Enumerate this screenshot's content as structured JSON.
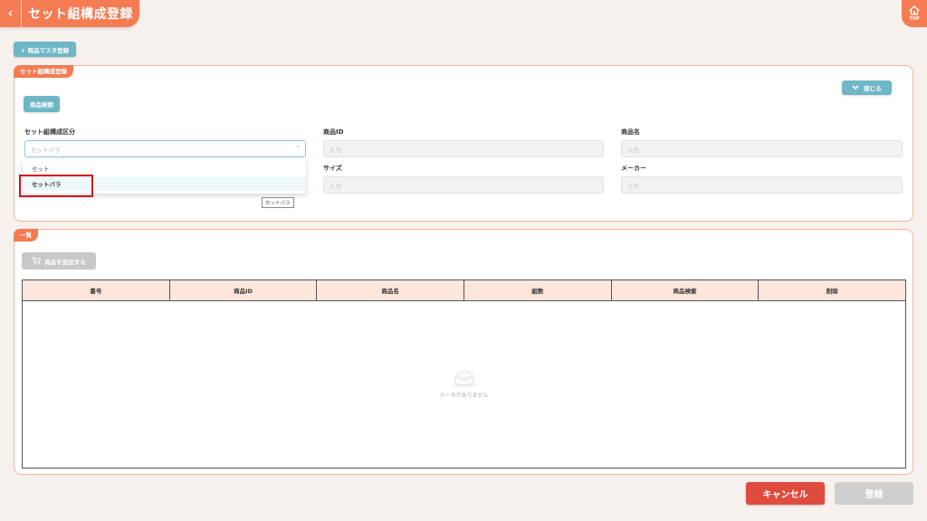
{
  "header": {
    "title": "セット組構成登録",
    "back_icon": "chevron-left-icon",
    "home_label": "TOP",
    "home_icon": "home-icon",
    "accent_color": "#f47b52"
  },
  "toolbar": {
    "master_register_label": "+ 商品マスタ登録"
  },
  "set_panel": {
    "tag": "セット組構成登録",
    "close_label": "閉じる",
    "product_search_label": "商品検索",
    "fields": {
      "set_type_label": "セット組構成区分",
      "set_type_value": "セットバラ",
      "product_id_label": "商品ID",
      "product_id_placeholder": "入力",
      "product_name_label": "商品名",
      "product_name_placeholder": "入力",
      "size_label": "サイズ",
      "size_placeholder": "入力",
      "maker_label": "メーカー",
      "maker_placeholder": "入力"
    },
    "dropdown_options": [
      "セット",
      "セットバラ"
    ],
    "tooltip": "セットバラ"
  },
  "list_panel": {
    "tag": "一覧",
    "add_product_label": "商品を追加する",
    "columns": [
      "番号",
      "商品ID",
      "商品名",
      "組数",
      "商品検索",
      "削除"
    ],
    "empty_text": "データがありません"
  },
  "footer": {
    "cancel_label": "キャンセル",
    "register_label": "登録",
    "cancel_color": "#e04b3f"
  }
}
